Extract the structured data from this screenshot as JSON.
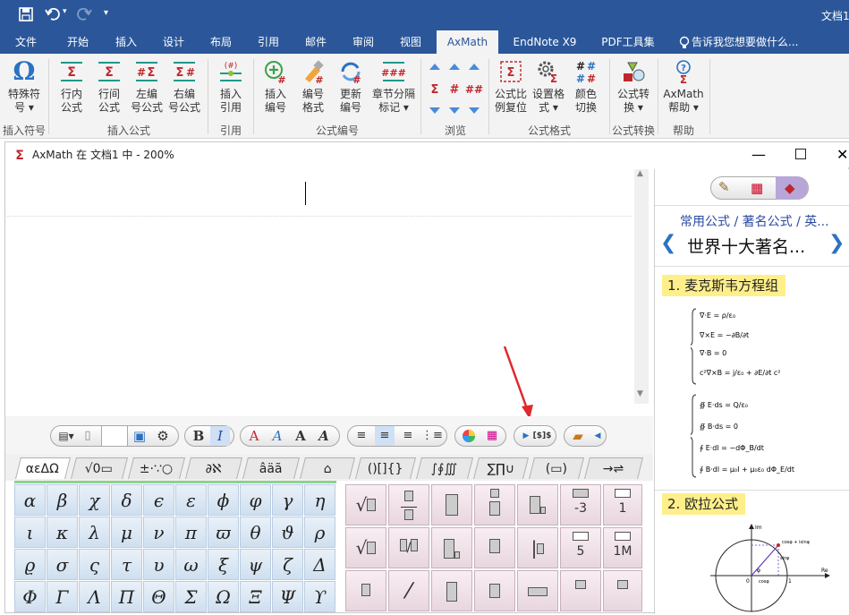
{
  "qat": {
    "save_icon": "save-icon",
    "undo_icon": "undo-icon",
    "redo_icon": "redo-icon",
    "customize_icon": "chevron-down-icon"
  },
  "window_title": "文档1",
  "ribbon_tabs": [
    {
      "label": "文件",
      "active": false
    },
    {
      "label": "开始",
      "active": false
    },
    {
      "label": "插入",
      "active": false
    },
    {
      "label": "设计",
      "active": false
    },
    {
      "label": "布局",
      "active": false
    },
    {
      "label": "引用",
      "active": false
    },
    {
      "label": "邮件",
      "active": false
    },
    {
      "label": "审阅",
      "active": false
    },
    {
      "label": "视图",
      "active": false
    },
    {
      "label": "AxMath",
      "active": true
    },
    {
      "label": "EndNote X9",
      "active": false
    },
    {
      "label": "PDF工具集",
      "active": false
    }
  ],
  "tell_me": "告诉我您想要做什么...",
  "ribbon": {
    "buttons": [
      {
        "line1": "特殊符",
        "line2": "号 ▾"
      },
      {
        "line1": "行内",
        "line2": "公式"
      },
      {
        "line1": "行间",
        "line2": "公式"
      },
      {
        "line1": "左编",
        "line2": "号公式"
      },
      {
        "line1": "右编",
        "line2": "号公式"
      },
      {
        "line1": "插入",
        "line2": "引用"
      },
      {
        "line1": "插入",
        "line2": "编号"
      },
      {
        "line1": "编号",
        "line2": "格式"
      },
      {
        "line1": "更新",
        "line2": "编号"
      },
      {
        "line1": "章节分隔",
        "line2": "标记 ▾"
      },
      {
        "line1": "公式比",
        "line2": "例复位"
      },
      {
        "line1": "设置格",
        "line2": "式 ▾"
      },
      {
        "line1": "颜色",
        "line2": "切换"
      },
      {
        "line1": "公式转",
        "line2": "换 ▾"
      },
      {
        "line1": "AxMath",
        "line2": "帮助 ▾"
      }
    ],
    "groups": [
      "插入符号",
      "插入公式",
      "引用",
      "公式编号",
      "浏览",
      "公式格式",
      "公式转换",
      "帮助"
    ]
  },
  "axmath": {
    "title": "AxMath 在 文档1 中 - 200%",
    "toolbar": {
      "bold": "B",
      "italic": "I",
      "font_a": [
        "A",
        "A",
        "A",
        "A"
      ]
    },
    "symbol_tabs": [
      "αεΔΩ",
      "√0▭",
      "±·∵○",
      "∂ℵ",
      "âäã",
      "⌂",
      "()[]{}",
      "∫∮∭",
      "∑∏∪",
      "(▭)",
      "→⇌"
    ],
    "greek": [
      [
        "α",
        "β",
        "χ",
        "δ",
        "ϵ",
        "ε",
        "ϕ",
        "φ",
        "γ",
        "η"
      ],
      [
        "ι",
        "κ",
        "λ",
        "μ",
        "ν",
        "π",
        "ϖ",
        "θ",
        "ϑ",
        "ρ"
      ],
      [
        "ϱ",
        "σ",
        "ς",
        "τ",
        "υ",
        "ω",
        "ξ",
        "ψ",
        "ζ",
        "Δ"
      ],
      [
        "Φ",
        "Γ",
        "Λ",
        "Π",
        "Θ",
        "Σ",
        "Ω",
        "Ξ",
        "Ψ",
        "ϒ"
      ]
    ],
    "template_labels": {
      "minus3": "-3",
      "one": "1",
      "five": "5",
      "onem": "1M"
    },
    "panel": {
      "breadcrumb": "常用公式 / 著名公式 / 英...",
      "heading": "世界十大著名...",
      "item1": "1. 麦克斯韦方程组",
      "item2": "2. 欧拉公式",
      "maxwell": [
        "∇·E = ρ/ε₀",
        "∇×E = −∂B/∂t",
        "∇·B = 0",
        "c²∇×B = j/ε₀ + ∂E/∂t c²",
        "∯ E·ds = Q/ε₀",
        "∯ B·ds = 0",
        "∮ E·dl = −dΦ_B/dt",
        "∮ B·dl = μ₀I + μ₀ε₀ dΦ_E/dt"
      ],
      "euler_labels": {
        "im": "Im",
        "re": "Re",
        "cos_isin": "cosφ + isinφ",
        "sin": "sinφ",
        "cos": "cosφ",
        "phi": "φ",
        "one": "1",
        "zero": "0"
      }
    }
  }
}
